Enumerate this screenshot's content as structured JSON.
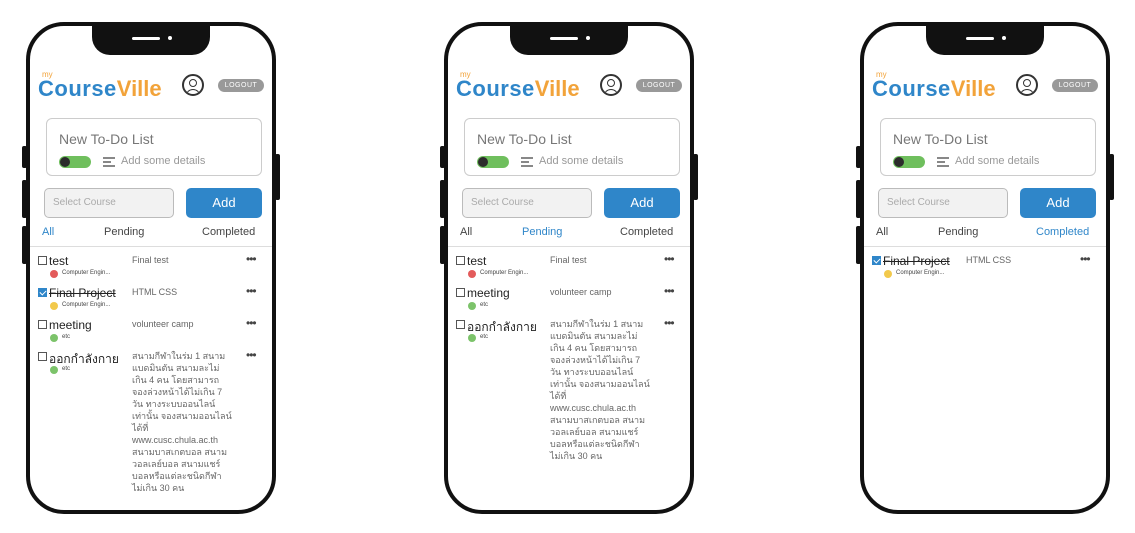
{
  "app": {
    "logo_my": "my",
    "logo_course": "Course",
    "logo_ville": "Ville",
    "logout_label": "LOGOUT",
    "todo_title": "New To-Do List",
    "details_placeholder": "Add some details",
    "select_placeholder": "Select Course",
    "add_label": "Add",
    "tabs": [
      "All",
      "Pending",
      "Completed"
    ]
  },
  "colors": {
    "accent": "#2f86c9",
    "brand_orange": "#f2a33a",
    "toggle_green": "#6fbf5d",
    "course_red": "#e35b5b",
    "course_yellow": "#f2c94c",
    "course_green": "#7cc36a"
  },
  "icons": [
    "user-circle-icon",
    "details-lines-icon",
    "more-dots-icon",
    "checkbox-icon"
  ],
  "screens": [
    {
      "active_tab": "All",
      "items": [
        {
          "name": "test",
          "checked": false,
          "course": "Computer Engin...",
          "course_color": "#e35b5b",
          "desc": "Final test"
        },
        {
          "name": "Final Project",
          "checked": true,
          "course": "Computer Engin...",
          "course_color": "#f2c94c",
          "desc": "HTML CSS"
        },
        {
          "name": "meeting",
          "checked": false,
          "course": "etc",
          "course_color": "#7cc36a",
          "desc": "volunteer camp"
        },
        {
          "name": "ออกกำลังกาย",
          "checked": false,
          "course": "etc",
          "course_color": "#7cc36a",
          "desc": "สนามกีฬาในร่ม 1 สนามแบดมินตัน สนามละไม่เกิน 4 คน โดยสามารถจองล่วงหน้าได้ไม่เกิน 7 วัน ทางระบบออนไลน์เท่านั้น จองสนามออนไลน์ได้ที่ www.cusc.chula.ac.th สนามบาสเกตบอล สนามวอลเลย์บอล สนามแชร์บอลหรือแต่ละชนิดกีฬาไม่เกิน 30 คน"
        }
      ]
    },
    {
      "active_tab": "Pending",
      "items": [
        {
          "name": "test",
          "checked": false,
          "course": "Computer Engin...",
          "course_color": "#e35b5b",
          "desc": "Final test"
        },
        {
          "name": "meeting",
          "checked": false,
          "course": "etc",
          "course_color": "#7cc36a",
          "desc": "volunteer camp"
        },
        {
          "name": "ออกกำลังกาย",
          "checked": false,
          "course": "etc",
          "course_color": "#7cc36a",
          "desc": "สนามกีฬาในร่ม 1 สนามแบดมินตัน สนามละไม่เกิน 4 คน โดยสามารถจองล่วงหน้าได้ไม่เกิน 7 วัน ทางระบบออนไลน์เท่านั้น จองสนามออนไลน์ได้ที่ www.cusc.chula.ac.th สนามบาสเกตบอล สนามวอลเลย์บอล สนามแชร์บอลหรือแต่ละชนิดกีฬาไม่เกิน 30 คน"
        }
      ]
    },
    {
      "active_tab": "Completed",
      "items": [
        {
          "name": "Final Project",
          "checked": true,
          "course": "Computer Engin...",
          "course_color": "#f2c94c",
          "desc": "HTML CSS"
        }
      ]
    }
  ]
}
